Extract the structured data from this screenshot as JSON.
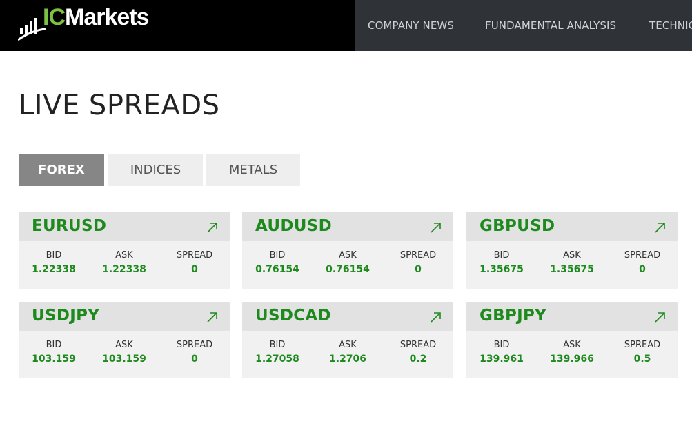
{
  "brand": {
    "logo_ic": "IC",
    "logo_markets": "Markets"
  },
  "nav": {
    "items": [
      "COMPANY NEWS",
      "FUNDAMENTAL ANALYSIS",
      "TECHNICAL ANALYSIS"
    ]
  },
  "page": {
    "title": "LIVE SPREADS"
  },
  "tabs": [
    {
      "label": "FOREX",
      "active": true
    },
    {
      "label": "INDICES",
      "active": false
    },
    {
      "label": "METALS",
      "active": false
    }
  ],
  "columns": {
    "bid": "BID",
    "ask": "ASK",
    "spread": "SPREAD"
  },
  "cards": [
    {
      "symbol": "EURUSD",
      "bid": "1.22338",
      "ask": "1.22338",
      "spread": "0"
    },
    {
      "symbol": "AUDUSD",
      "bid": "0.76154",
      "ask": "0.76154",
      "spread": "0"
    },
    {
      "symbol": "GBPUSD",
      "bid": "1.35675",
      "ask": "1.35675",
      "spread": "0"
    },
    {
      "symbol": "USDJPY",
      "bid": "103.159",
      "ask": "103.159",
      "spread": "0"
    },
    {
      "symbol": "USDCAD",
      "bid": "1.27058",
      "ask": "1.2706",
      "spread": "0.2"
    },
    {
      "symbol": "GBPJPY",
      "bid": "139.961",
      "ask": "139.966",
      "spread": "0.5"
    }
  ],
  "colors": {
    "accent_green": "#1e8a1e",
    "logo_green": "#7cc242",
    "nav_bg": "#2f3237",
    "active_tab": "#868686"
  },
  "icons": {
    "trend": "arrow-up-right-icon"
  }
}
